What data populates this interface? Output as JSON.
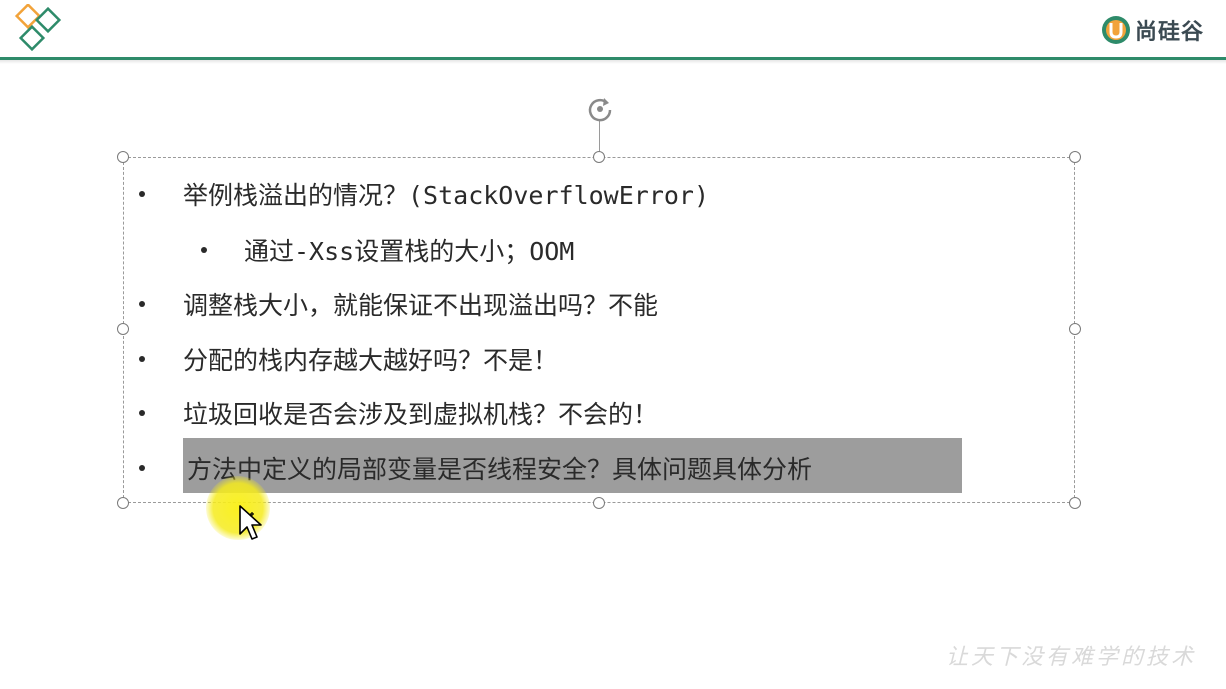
{
  "header": {
    "brand_name": "尚硅谷",
    "brand_color": "#2e8b6a"
  },
  "slide": {
    "bullets": [
      {
        "level": 1,
        "text": "举例栈溢出的情况？(StackOverflowError)"
      },
      {
        "level": 2,
        "text": "通过-Xss设置栈的大小；OOM"
      },
      {
        "level": 1,
        "text": "调整栈大小，就能保证不出现溢出吗？不能"
      },
      {
        "level": 1,
        "text": "分配的栈内存越大越好吗？不是！"
      },
      {
        "level": 1,
        "text": "垃圾回收是否会涉及到虚拟机栈？不会的！"
      },
      {
        "level": 1,
        "text": "方法中定义的局部变量是否线程安全？具体问题具体分析",
        "selected": true
      }
    ]
  },
  "watermark": "让天下没有难学的技术",
  "icons": {
    "logo": "diamond-logo-icon",
    "rotate": "rotate-handle-icon",
    "cursor": "mouse-pointer-icon"
  },
  "colors": {
    "selection_highlight": "#9d9d9d",
    "cursor_halo": "#f5eb1e"
  }
}
